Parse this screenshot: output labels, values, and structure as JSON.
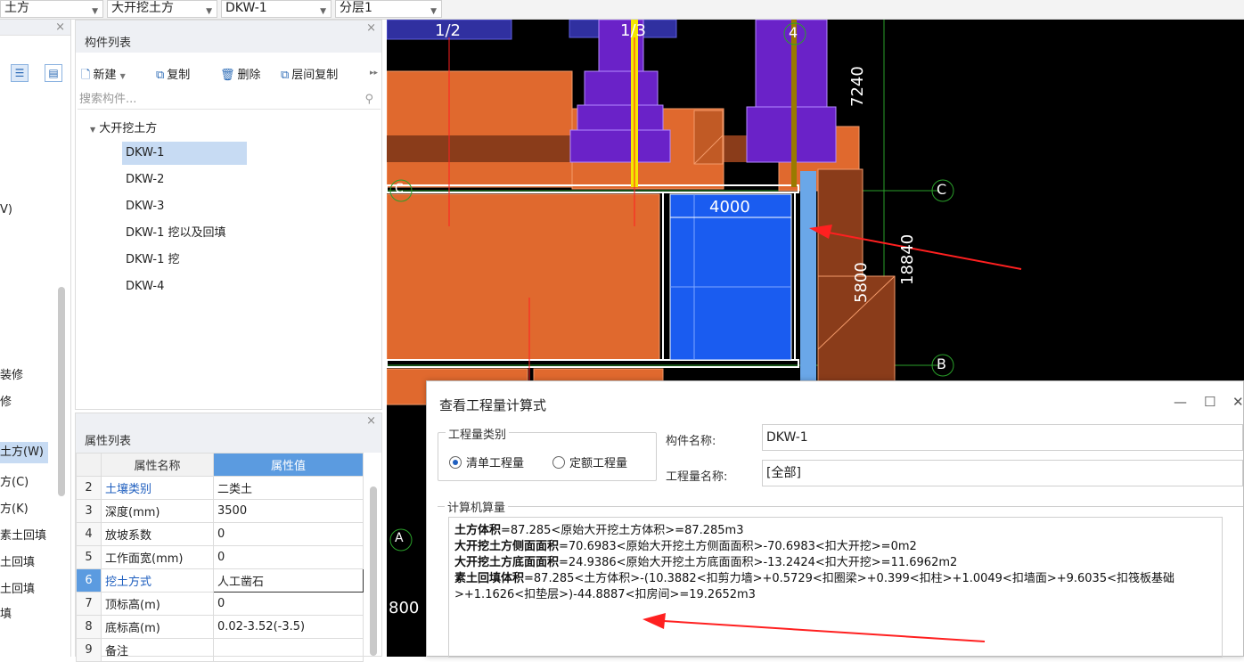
{
  "topbar": {
    "combos": [
      {
        "value": "土方"
      },
      {
        "value": "大开挖土方"
      },
      {
        "value": "DKW-1"
      },
      {
        "value": "分层1"
      }
    ]
  },
  "left_strip": {
    "items": [
      "V)",
      "装修",
      "修",
      "土方(W)",
      "方(C)",
      "方(K)",
      "素土回填",
      "土回填",
      "土回填",
      "填"
    ]
  },
  "component_list": {
    "title": "构件列表",
    "toolbar": {
      "new": "新建",
      "copy": "复制",
      "delete": "删除",
      "floor_copy": "层间复制"
    },
    "search_placeholder": "搜索构件...",
    "group": "大开挖土方",
    "items": [
      "DKW-1",
      "DKW-2",
      "DKW-3",
      "DKW-1 挖以及回填",
      "DKW-1 挖",
      "DKW-4"
    ]
  },
  "property_list": {
    "title": "属性列表",
    "col_name": "属性名称",
    "col_value": "属性值",
    "rows": [
      {
        "num": "2",
        "name": "土壤类别",
        "value": "二类土"
      },
      {
        "num": "3",
        "name": "深度(mm)",
        "value": "3500"
      },
      {
        "num": "4",
        "name": "放坡系数",
        "value": "0"
      },
      {
        "num": "5",
        "name": "工作面宽(mm)",
        "value": "0"
      },
      {
        "num": "6",
        "name": "挖土方式",
        "value": "人工凿石"
      },
      {
        "num": "7",
        "name": "顶标高(m)",
        "value": "0"
      },
      {
        "num": "8",
        "name": "底标高(m)",
        "value": "0.02-3.52(-3.5)"
      },
      {
        "num": "9",
        "name": "备注",
        "value": ""
      }
    ]
  },
  "cad": {
    "axis_labels": {
      "a12": "1/2",
      "a13": "1/3",
      "a4": "4",
      "c_left": "C",
      "c_right": "C",
      "b_right": "B",
      "a_left": "A"
    },
    "dims": {
      "d7240": "7240",
      "d4000": "4000",
      "d5800": "5800",
      "d18840": "18840",
      "d800": "800"
    }
  },
  "dialog": {
    "title": "查看工程量计算式",
    "qty_type_legend": "工程量类别",
    "radio_list": "清单工程量",
    "radio_quota": "定额工程量",
    "comp_name_label": "构件名称:",
    "comp_name_value": "DKW-1",
    "qty_name_label": "工程量名称:",
    "qty_name_value": "[全部]",
    "calc_legend": "计算机算量",
    "lines": [
      {
        "k": "土方体积",
        "v": "=87.285<原始大开挖土方体积>=87.285m3"
      },
      {
        "k": "大开挖土方侧面面积",
        "v": "=70.6983<原始大开挖土方侧面面积>-70.6983<扣大开挖>=0m2"
      },
      {
        "k": "大开挖土方底面面积",
        "v": "=24.9386<原始大开挖土方底面面积>-13.2424<扣大开挖>=11.6962m2"
      },
      {
        "k": "素土回填体积",
        "v": "=87.285<土方体积>-(10.3882<扣剪力墙>+0.5729<扣圈梁>+0.399<扣柱>+1.0049<扣墙面>+9.6035<扣筏板基础>+1.1626<扣垫层>)-44.8887<扣房间>=19.2652m3"
      }
    ]
  }
}
